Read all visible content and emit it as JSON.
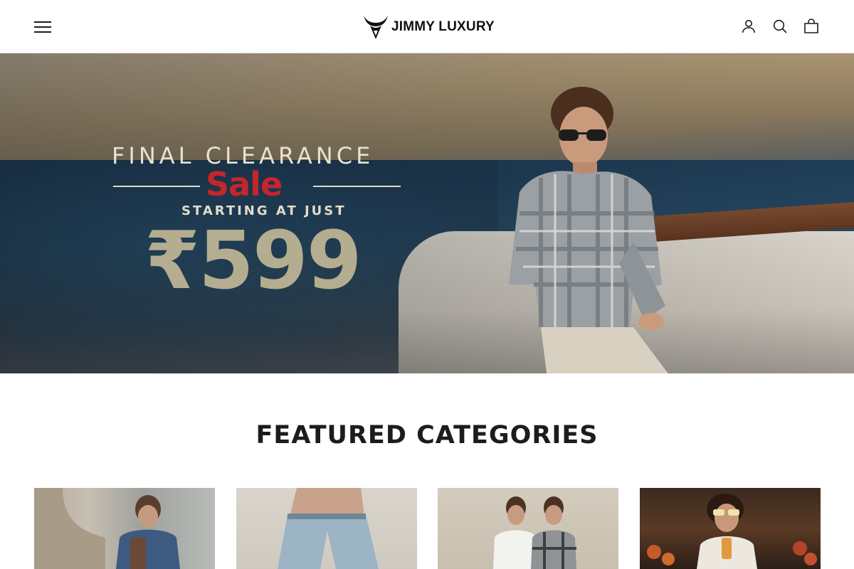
{
  "brand": {
    "name": "JIMMY LUXURY",
    "logo_icon": "bull-horns-icon"
  },
  "header": {
    "menu_icon": "hamburger-menu-icon",
    "icons": [
      "account-icon",
      "search-icon",
      "cart-icon"
    ]
  },
  "hero": {
    "line1": "FINAL CLEARANCE",
    "sale": "Sale",
    "starting": "STARTING AT JUST",
    "price": "₹599",
    "colors": {
      "sale": "#c4262b",
      "price": "#b4ad8f",
      "headline": "#e7e1d3"
    }
  },
  "featured": {
    "title": "FEATURED CATEGORIES",
    "cards": [
      {
        "name": "category-card-1"
      },
      {
        "name": "category-card-2"
      },
      {
        "name": "category-card-3"
      },
      {
        "name": "category-card-4"
      }
    ]
  }
}
